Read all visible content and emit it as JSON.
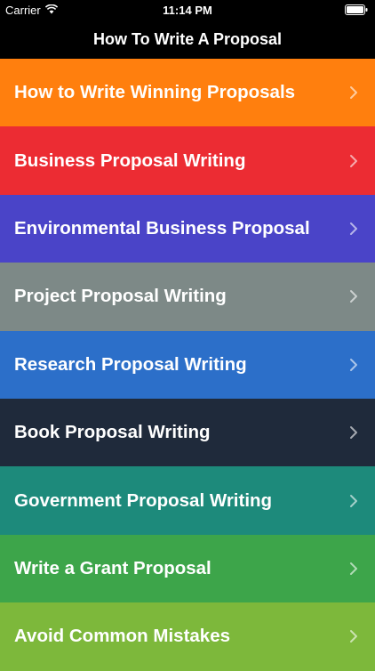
{
  "status_bar": {
    "carrier": "Carrier",
    "time": "11:14 PM",
    "wifi_icon": "wifi-icon",
    "battery_icon": "battery-icon"
  },
  "nav": {
    "title": "How To Write A Proposal"
  },
  "menu": {
    "items": [
      {
        "label": "How to Write Winning Proposals",
        "color": "#FF7F0E"
      },
      {
        "label": "Business Proposal Writing",
        "color": "#EC2C33"
      },
      {
        "label": "Environmental Business Proposal",
        "color": "#4A44C8"
      },
      {
        "label": "Project Proposal Writing",
        "color": "#7D8987"
      },
      {
        "label": "Research Proposal Writing",
        "color": "#2C6FC9"
      },
      {
        "label": "Book Proposal Writing",
        "color": "#1F2A3B"
      },
      {
        "label": "Government Proposal Writing",
        "color": "#1D8A7B"
      },
      {
        "label": "Write a Grant Proposal",
        "color": "#3DA54A"
      },
      {
        "label": "Avoid Common Mistakes",
        "color": "#7DB83B"
      }
    ]
  }
}
